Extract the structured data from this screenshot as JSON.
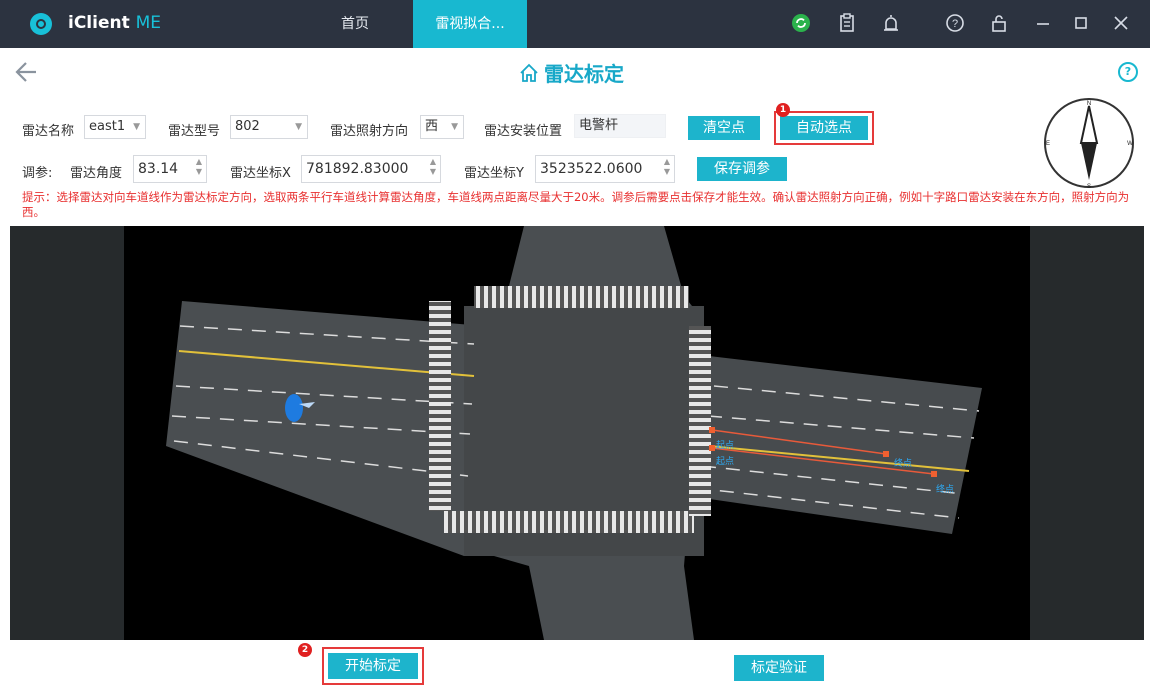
{
  "app": {
    "name_main": "iClient",
    "name_accent": "ME"
  },
  "tabs": [
    {
      "label": "首页"
    },
    {
      "label": "雷视拟合..."
    }
  ],
  "header": {
    "title": "雷达标定"
  },
  "form": {
    "radar_name_label": "雷达名称",
    "radar_name_value": "east1",
    "radar_model_label": "雷达型号",
    "radar_model_value": "802",
    "radar_dir_label": "雷达照射方向",
    "radar_dir_value": "西",
    "radar_pos_label": "雷达安装位置",
    "radar_pos_value": "电警杆",
    "clear_btn": "清空点",
    "auto_btn": "自动选点",
    "adjust_label": "调参:",
    "angle_label": "雷达角度",
    "angle_value": "83.14",
    "x_label": "雷达坐标X",
    "x_value": "781892.83000",
    "y_label": "雷达坐标Y",
    "y_value": "3523522.0600",
    "save_btn": "保存调参"
  },
  "hint": "提示：选择雷达对向车道线作为雷达标定方向，选取两条平行车道线计算雷达角度，车道线两点距离尽量大于20米。调参后需要点击保存才能生效。确认雷达照射方向正确，例如十字路口雷达安装在东方向，照射方向为西。",
  "badges": {
    "one": "1",
    "two": "2"
  },
  "compass": {
    "n": "N",
    "s": "S",
    "e": "E",
    "w": "W"
  },
  "map_labels": {
    "p1": "起点",
    "p2": "终点",
    "p3": "起点",
    "p4": "终点"
  },
  "bottom": {
    "start_btn": "开始标定",
    "verify_btn": "标定验证"
  },
  "colors": {
    "accent": "#1db4cc",
    "titlebar": "#2c3340",
    "alert": "#e53a3a"
  }
}
